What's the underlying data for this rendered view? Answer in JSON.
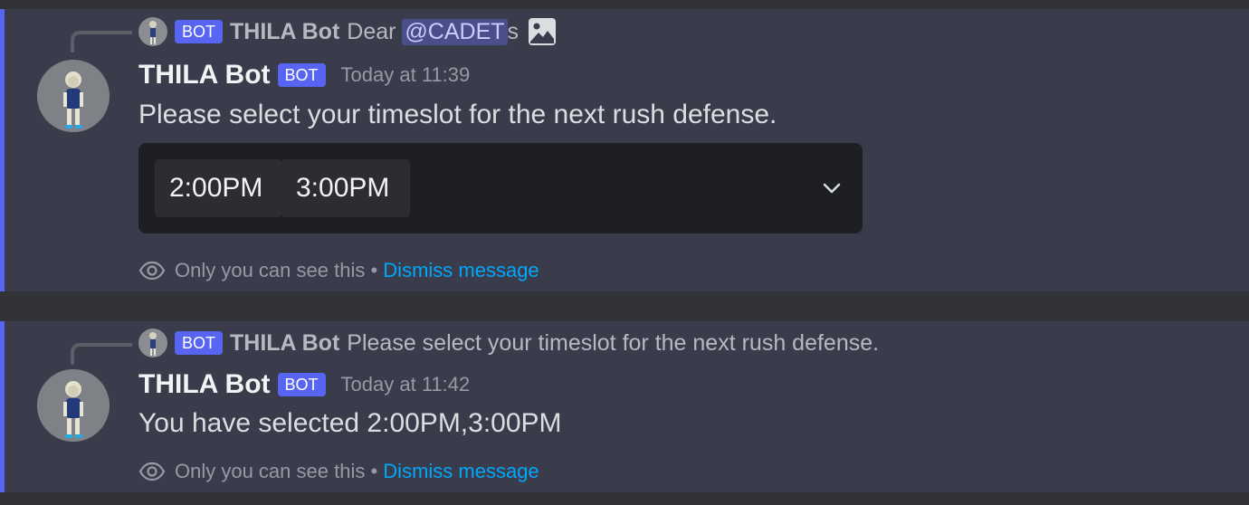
{
  "messages": [
    {
      "reply": {
        "bot_tag": "BOT",
        "author": "THILA Bot",
        "text_before": "Dear",
        "mention": "@CADET",
        "text_after": "s",
        "attachment_icon": "image-icon"
      },
      "author": "THILA Bot",
      "bot_tag": "BOT",
      "timestamp": "Today at 11:39",
      "content": "Please select your timeslot for the next rush defense.",
      "select": {
        "selected": [
          "2:00PM",
          "3:00PM"
        ],
        "dropdown_icon": "chevron-down-icon"
      },
      "ephemeral": {
        "notice": "Only you can see this",
        "separator": "•",
        "dismiss": "Dismiss message"
      }
    },
    {
      "reply": {
        "bot_tag": "BOT",
        "author": "THILA Bot",
        "text": "Please select your timeslot for the next rush defense."
      },
      "author": "THILA Bot",
      "bot_tag": "BOT",
      "timestamp": "Today at 11:42",
      "content": "You have selected 2:00PM,3:00PM",
      "ephemeral": {
        "notice": "Only you can see this",
        "separator": "•",
        "dismiss": "Dismiss message"
      }
    }
  ],
  "colors": {
    "background": "#313338",
    "message_highlight": "#3b3c4b",
    "accent": "#5865f2",
    "link": "#00a8fc"
  }
}
